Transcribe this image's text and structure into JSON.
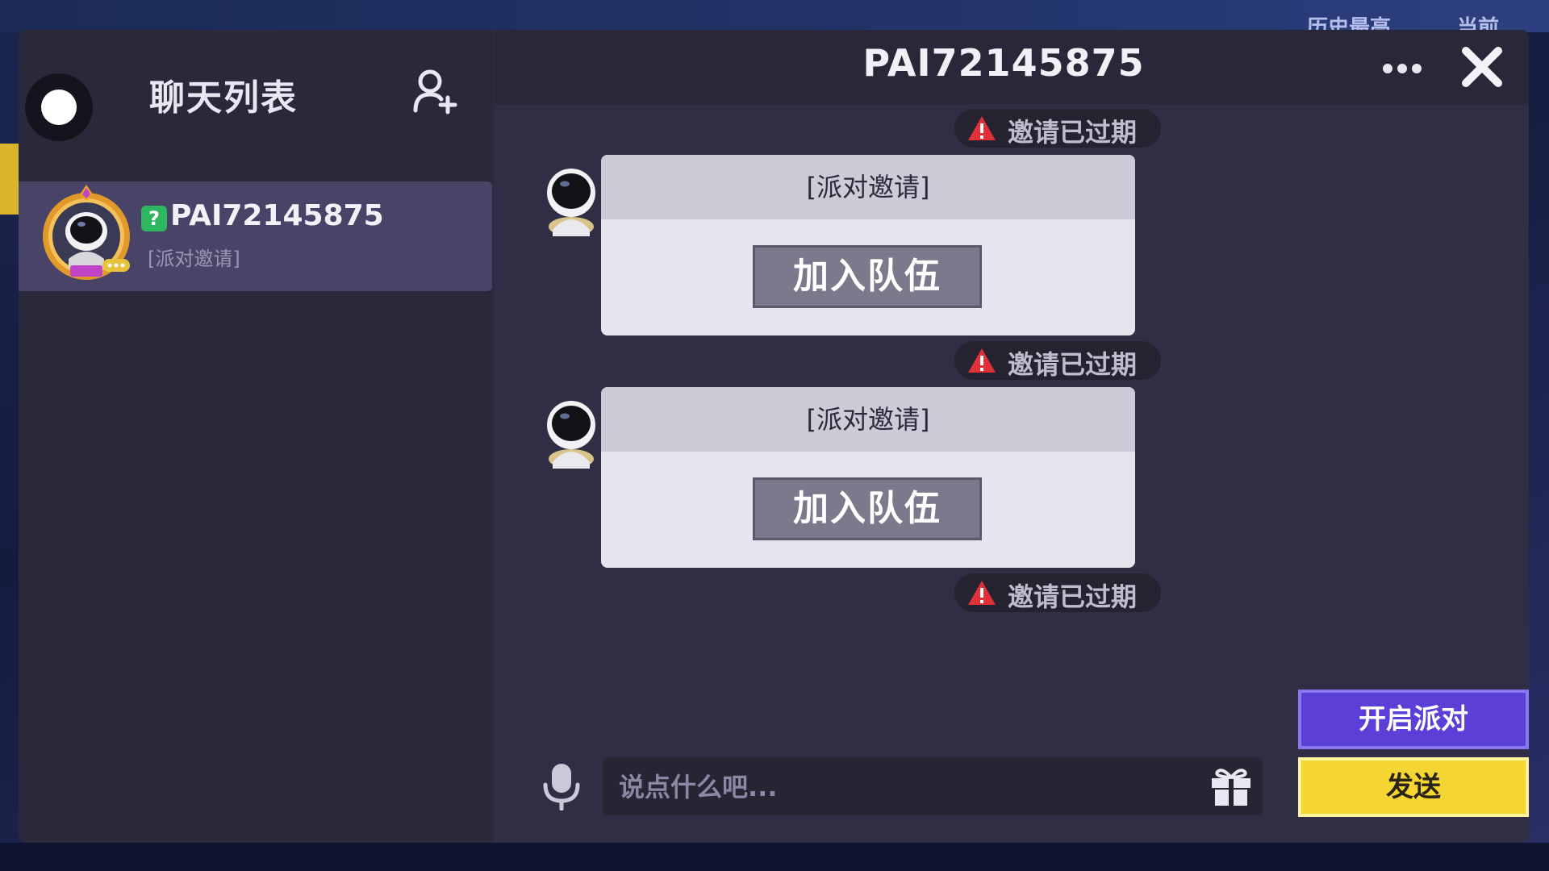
{
  "background": {
    "labels": [
      "历史最高",
      "当前"
    ]
  },
  "sidebar": {
    "title": "聊天列表",
    "add_friend_icon": "add-user-icon",
    "chats": [
      {
        "name": "PAI72145875",
        "preview": "[派对邀请]",
        "online_badge": "?"
      }
    ]
  },
  "chat": {
    "title": "PAI72145875",
    "messages": [
      {
        "type": "status",
        "text": "邀请已过期"
      },
      {
        "type": "invite",
        "header": "[派对邀请]",
        "button": "加入队伍"
      },
      {
        "type": "status",
        "text": "邀请已过期"
      },
      {
        "type": "invite",
        "header": "[派对邀请]",
        "button": "加入队伍"
      },
      {
        "type": "status",
        "text": "邀请已过期"
      }
    ]
  },
  "composer": {
    "placeholder": "说点什么吧...",
    "start_party_label": "开启派对",
    "send_label": "发送"
  },
  "colors": {
    "accent_purple": "#5b3fd6",
    "send_yellow": "#f5d532",
    "warning_red": "#e0303a",
    "online_green": "#2fb760"
  }
}
